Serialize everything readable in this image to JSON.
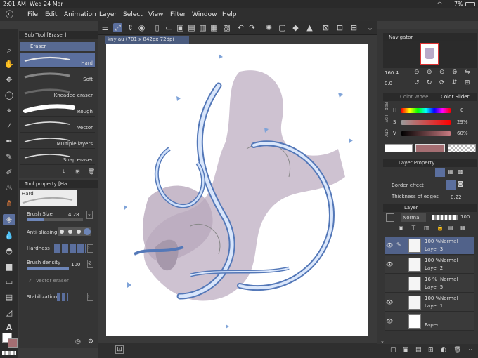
{
  "status": {
    "time": "2:01 AM",
    "date": "Wed 24 Mar",
    "battery": "7%"
  },
  "menu": [
    "File",
    "Edit",
    "Animation",
    "Layer",
    "Select",
    "View",
    "Filter",
    "Window",
    "Help"
  ],
  "subtool": {
    "header": "Sub Tool [Eraser]",
    "group": "Eraser",
    "brushes": [
      "Hard",
      "Soft",
      "Kneaded eraser",
      "Rough",
      "Vector",
      "Multiple layers",
      "Snap eraser"
    ]
  },
  "toolprop": {
    "header": "Tool property [Ha",
    "preset": "Hard",
    "brush_size_label": "Brush Size",
    "brush_size_value": "4.28",
    "antialias_label": "Anti-aliasing",
    "hardness_label": "Hardness",
    "density_label": "Brush density",
    "density_value": "100",
    "vector_label": "Vector eraser",
    "stabilization_label": "Stabilization"
  },
  "canvas": {
    "tab": "kny au (701 x 842px 72dpi 160.4%)"
  },
  "navigator": {
    "header": "Navigator",
    "zoom": "160.4",
    "angle": "0.0"
  },
  "color": {
    "tab_wheel": "Color Wheel",
    "tab_slider": "Color Slider",
    "h_label": "H",
    "h_value": "0",
    "s_label": "S",
    "s_value": "29%",
    "v_label": "V",
    "v_value": "60%",
    "side_labels": [
      "RGB",
      "HSV",
      "CMY"
    ],
    "main_color": "#a46e72",
    "sub_color": "#ffffff"
  },
  "layerprop": {
    "header": "Layer Property",
    "effect": "Border effect",
    "thickness": "Thickness of edges",
    "thickness_value": "0.22"
  },
  "layers": {
    "header": "Layer",
    "blend": "Normal",
    "opacity": "100",
    "items": [
      {
        "opacity": "100 %",
        "mode": "Normal",
        "name": "Layer 3"
      },
      {
        "opacity": "100 %",
        "mode": "Normal",
        "name": "Layer 2"
      },
      {
        "opacity": "16 %",
        "mode": "Normal",
        "name": "Layer 5"
      },
      {
        "opacity": "100 %",
        "mode": "Normal",
        "name": "Layer 1"
      },
      {
        "opacity": "",
        "mode": "",
        "name": "Paper"
      }
    ]
  }
}
